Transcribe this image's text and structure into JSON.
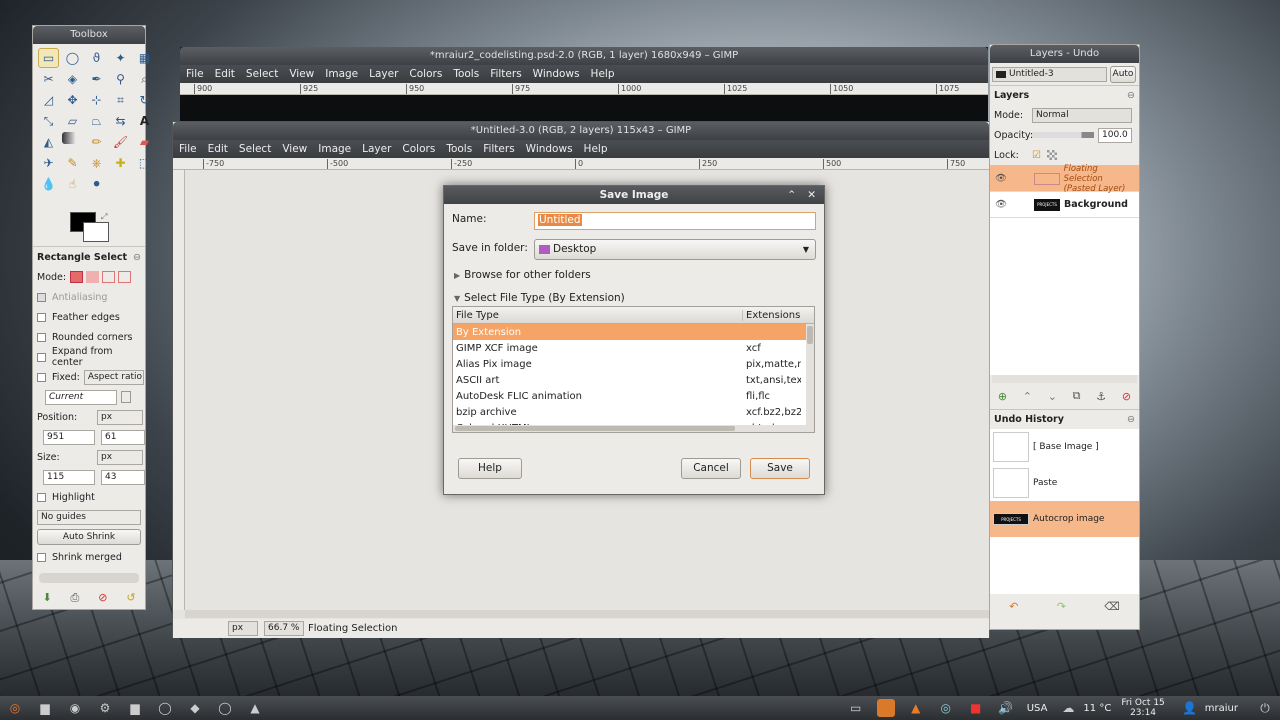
{
  "toolbox": {
    "title": "Toolbox",
    "tool_name": "Rectangle Select",
    "mode_label": "Mode:",
    "antialiasing": "Antialiasing",
    "feather": "Feather edges",
    "rounded": "Rounded corners",
    "expand": "Expand from center",
    "fixed_label": "Fixed:",
    "fixed_value": "Aspect ratio",
    "current": "Current",
    "position_label": "Position:",
    "position_unit": "px",
    "pos_x": "951",
    "pos_y": "61",
    "size_label": "Size:",
    "size_unit": "px",
    "size_w": "115",
    "size_h": "43",
    "highlight": "Highlight",
    "guides": "No guides",
    "auto_shrink": "Auto Shrink",
    "shrink_merged": "Shrink merged"
  },
  "back_window": {
    "title": "*mraiur2_codelisting.psd-2.0 (RGB, 1 layer) 1680x949 – GIMP",
    "menu": [
      "File",
      "Edit",
      "Select",
      "View",
      "Image",
      "Layer",
      "Colors",
      "Tools",
      "Filters",
      "Windows",
      "Help"
    ],
    "ruler": [
      "900",
      "925",
      "950",
      "975",
      "1000",
      "1025",
      "1050",
      "1075"
    ]
  },
  "front_window": {
    "title": "*Untitled-3.0 (RGB, 2 layers) 115x43 – GIMP",
    "menu": [
      "File",
      "Edit",
      "Select",
      "View",
      "Image",
      "Layer",
      "Colors",
      "Tools",
      "Filters",
      "Windows",
      "Help"
    ],
    "ruler": [
      "-750",
      "-500",
      "-250",
      "0",
      "250",
      "500",
      "750"
    ],
    "unit": "px",
    "zoom": "66.7 %",
    "status": "Floating Selection"
  },
  "dialog": {
    "title": "Save Image",
    "name_label": "Name:",
    "name_value": "Untitled",
    "folder_label": "Save in folder:",
    "folder_value": "Desktop",
    "browse": "Browse for other folders",
    "select_type": "Select File Type (By Extension)",
    "col_type": "File Type",
    "col_ext": "Extensions",
    "rows": [
      {
        "type": "By Extension",
        "ext": ""
      },
      {
        "type": "GIMP XCF image",
        "ext": "xcf"
      },
      {
        "type": "Alias Pix image",
        "ext": "pix,matte,m"
      },
      {
        "type": "ASCII art",
        "ext": "txt,ansi,tex"
      },
      {
        "type": "AutoDesk FLIC animation",
        "ext": "fli,flc"
      },
      {
        "type": "bzip archive",
        "ext": "xcf.bz2,bz2"
      },
      {
        "type": "Colored XHTML",
        "ext": "xhtml"
      }
    ],
    "help": "Help",
    "cancel": "Cancel",
    "save": "Save"
  },
  "layers": {
    "title": "Layers - Undo",
    "image_select": "Untitled-3",
    "auto": "Auto",
    "section": "Layers",
    "mode_label": "Mode:",
    "mode_value": "Normal",
    "opacity_label": "Opacity:",
    "opacity_value": "100.0",
    "lock_label": "Lock:",
    "floating_name": "Floating Selection",
    "floating_sub": "(Pasted Layer)",
    "background_name": "Background",
    "thumb_text": "PROJECTS",
    "undo_section": "Undo History",
    "history": [
      "[ Base Image ]",
      "Paste",
      "Autocrop image"
    ]
  },
  "taskbar": {
    "kb_layout": "USA",
    "temp": "11 °C",
    "date": "Fri Oct 15",
    "time": "23:14",
    "user": "mraiur"
  }
}
